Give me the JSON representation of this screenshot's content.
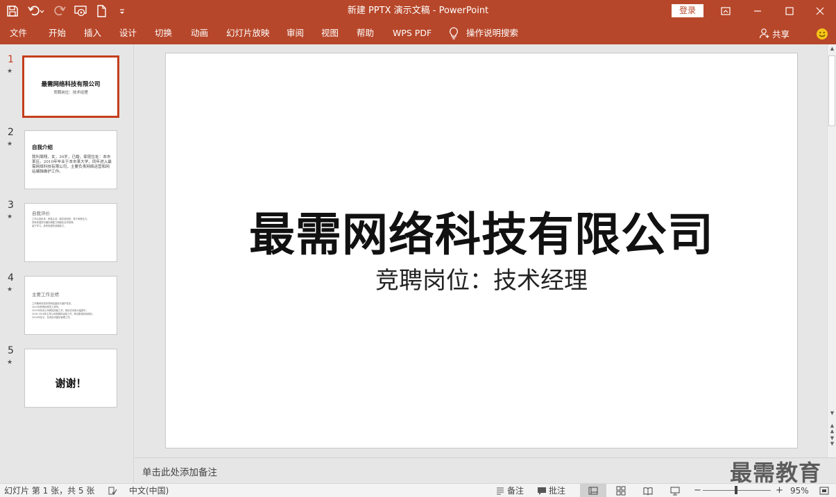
{
  "titlebar": {
    "title": "新建 PPTX 演示文稿  -  PowerPoint",
    "login_label": "登录",
    "colors": {
      "accent": "#b7472a",
      "selection": "#c43e1c"
    },
    "quick_access_icons": [
      "save-icon",
      "undo-icon",
      "redo-icon",
      "slideshow-from-start-icon",
      "new-file-icon",
      "customize-icon"
    ],
    "window_controls": [
      "ribbon-display-options-icon",
      "minimize-icon",
      "maximize-icon",
      "close-icon"
    ]
  },
  "ribbon": {
    "tabs": [
      {
        "label": "文件"
      },
      {
        "label": "开始"
      },
      {
        "label": "插入"
      },
      {
        "label": "设计"
      },
      {
        "label": "切换"
      },
      {
        "label": "动画"
      },
      {
        "label": "幻灯片放映"
      },
      {
        "label": "审阅"
      },
      {
        "label": "视图"
      },
      {
        "label": "帮助"
      },
      {
        "label": "WPS PDF"
      }
    ],
    "tell_me": "操作说明搜索",
    "share": "共享"
  },
  "thumbnails": [
    {
      "number": "1",
      "title": "最需网络科技有限公司",
      "subtitle": "竞聘岗位：技术经理"
    },
    {
      "number": "2",
      "title": "自我介绍",
      "body": "我叫周翔，女，30岁，已婚，家庭住址：本市某区。2010年毕业于本市某大学，同年进入最需网络科技有限公司，主要负责网络运营和网站编辑维护工作。"
    },
    {
      "number": "3",
      "title": "自我评价",
      "lines": [
        "工作认真负责，积极主动，能吃苦耐劳，勇于承受压力。",
        "具有较强的沟通协调能力和团队合作精神。",
        "善于学习，具有较强的创新能力。"
      ]
    },
    {
      "number": "4",
      "title": "主要工作业绩",
      "lines": [
        "工作期间完成多项网站建设与维护任务。",
        "2013年获得优秀员工称号。",
        "2015年负责公司网站改版工作，网站访问量大幅提升。",
        "2016-2018年主导公司新媒体运营工作，粉丝数量持续增长。",
        "2019年至今，负责技术团队管理工作。"
      ]
    },
    {
      "number": "5",
      "title": "谢谢！"
    }
  ],
  "slide": {
    "title": "最需网络科技有限公司",
    "subtitle": "竞聘岗位：技术经理"
  },
  "notes": {
    "placeholder": "单击此处添加备注",
    "watermark": "最需教育"
  },
  "statusbar": {
    "slide_info": "幻灯片 第 1 张，共 5 张",
    "language": "中文(中国)",
    "notes": "备注",
    "comments": "批注",
    "zoom": "95%",
    "zoom_value": 0.95
  }
}
